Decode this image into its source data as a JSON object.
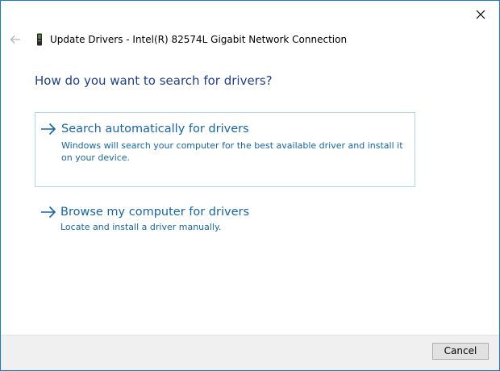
{
  "window": {
    "title": "Update Drivers - Intel(R) 82574L Gigabit Network Connection",
    "close_icon": "close-icon",
    "back_icon": "back-arrow-icon",
    "device_icon": "network-device-icon"
  },
  "main": {
    "heading": "How do you want to search for drivers?",
    "options": [
      {
        "title": "Search automatically for drivers",
        "description": "Windows will search your computer for the best available driver and install it on your device.",
        "icon": "arrow-right-icon"
      },
      {
        "title": "Browse my computer for drivers",
        "description": "Locate and install a driver manually.",
        "icon": "arrow-right-icon"
      }
    ]
  },
  "footer": {
    "cancel_label": "Cancel"
  },
  "colors": {
    "accent": "#1565a8",
    "heading": "#1e3f8f",
    "window_border": "#1979ca",
    "footer_bg": "#f0f0f0"
  }
}
